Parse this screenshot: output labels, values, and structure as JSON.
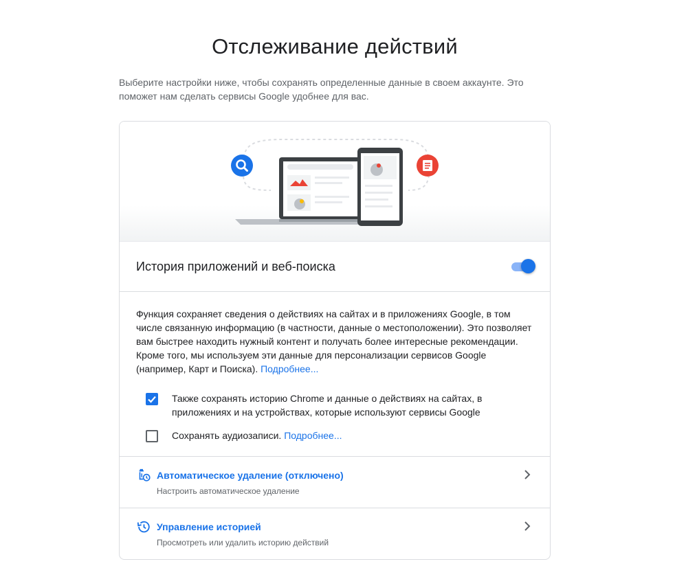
{
  "page": {
    "title": "Отслеживание действий",
    "intro": "Выберите настройки ниже, чтобы сохранять определенные данные в своем аккаунте. Это поможет нам сделать сервисы Google удобнее для вас."
  },
  "setting": {
    "title": "История приложений и веб-поиска",
    "enabled": true,
    "description": "Функция сохраняет сведения о действиях на сайтах и в приложениях Google, в том числе связанную информацию (в частности, данные о местоположении). Это позволяет вам быстрее находить нужный контент и получать более интересные рекомендации. Кроме того, мы используем эти данные для персонализации сервисов Google (например, Карт и Поиска).",
    "learn_more": "Подробнее..."
  },
  "checkboxes": [
    {
      "label": "Также сохранять историю Chrome и данные о действиях на сайтах, в приложениях и на устройствах, которые используют сервисы Google",
      "checked": true
    },
    {
      "label": "Сохранять аудиозаписи.",
      "link": "Подробнее...",
      "checked": false
    }
  ],
  "nav": [
    {
      "title": "Автоматическое удаление (отключено)",
      "subtitle": "Настроить автоматическое удаление",
      "icon": "auto-delete-icon"
    },
    {
      "title": "Управление историей",
      "subtitle": "Просмотреть или удалить историю действий",
      "icon": "history-icon"
    }
  ],
  "colors": {
    "accent": "#1a73e8",
    "toggle_track": "#8ab4f8",
    "search_badge": "#1a73e8",
    "doc_badge": "#ea4335"
  }
}
